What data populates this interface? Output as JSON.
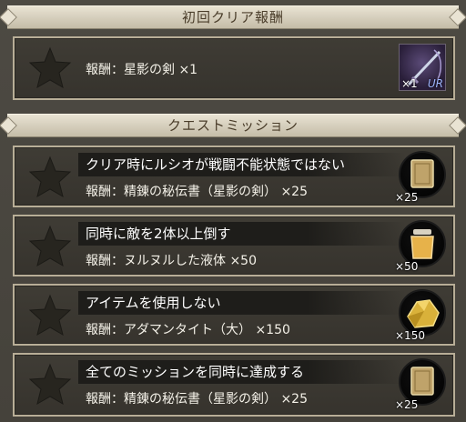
{
  "first_clear": {
    "header": "初回クリア報酬",
    "reward_text": "報酬：星影の剣 ×1",
    "item_icon": "sword-icon",
    "item_count": "×1",
    "item_rank": "UR"
  },
  "quest_missions": {
    "header": "クエストミッション",
    "missions": [
      {
        "title": "クリア時にルシオが戦闘不能状態ではない",
        "reward": "報酬：精錬の秘伝書（星影の剣） ×25",
        "item_icon": "tome-icon",
        "item_count": "×25"
      },
      {
        "title": "同時に敵を2体以上倒す",
        "reward": "報酬：ヌルヌルした液体 ×50",
        "item_icon": "liquid-jar-icon",
        "item_count": "×50"
      },
      {
        "title": "アイテムを使用しない",
        "reward": "報酬：アダマンタイト（大） ×150",
        "item_icon": "gold-ore-icon",
        "item_count": "×150"
      },
      {
        "title": "全てのミッションを同時に達成する",
        "reward": "報酬：精錬の秘伝書（星影の剣） ×25",
        "item_icon": "tome-icon",
        "item_count": "×25"
      }
    ]
  },
  "colors": {
    "header_bg": "#ddd6c4",
    "card_border": "#b8ae97",
    "star": "#2a2824"
  }
}
